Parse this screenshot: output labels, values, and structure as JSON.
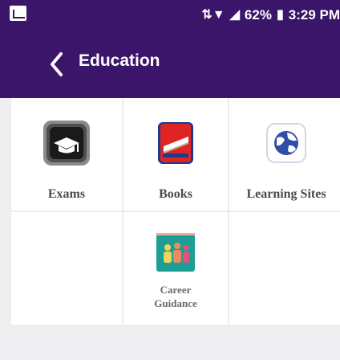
{
  "status_bar": {
    "battery_percent": "62%",
    "time": "3:29 PM"
  },
  "app_bar": {
    "title": "Education"
  },
  "categories": [
    {
      "label": "Exams",
      "icon": "graduation-cap-icon"
    },
    {
      "label": "Books",
      "icon": "book-icon"
    },
    {
      "label": "Learning Sites",
      "icon": "globe-icon"
    },
    {
      "label": "Career\nGuidance",
      "icon": "people-icon"
    }
  ],
  "colors": {
    "app_bar": "#3a1569",
    "background": "#efeff2",
    "tile": "#ffffff",
    "label": "#4a4a4a",
    "icon_tile": "#1d9e95"
  }
}
